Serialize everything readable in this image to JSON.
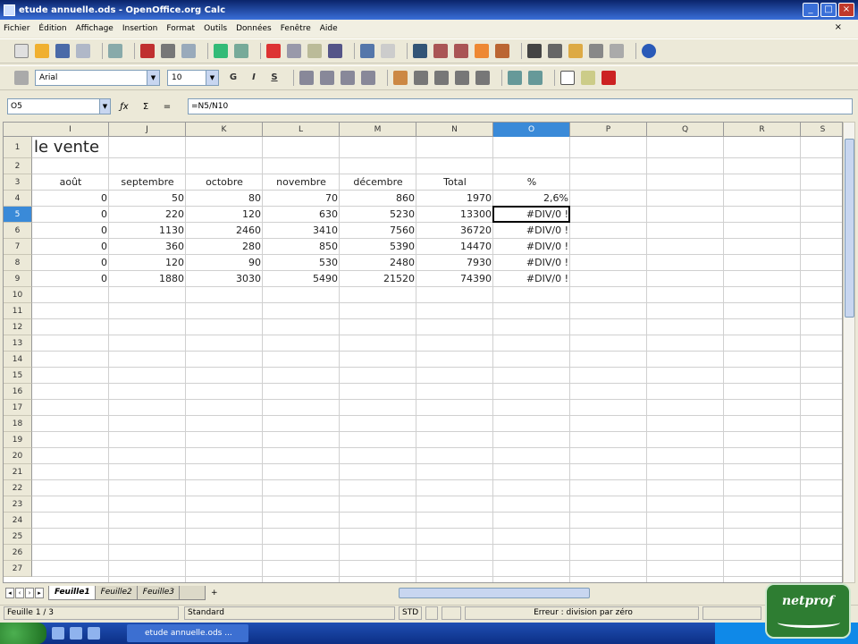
{
  "window": {
    "title": "etude annuelle.ods - OpenOffice.org Calc"
  },
  "menu": [
    "Fichier",
    "Édition",
    "Affichage",
    "Insertion",
    "Format",
    "Outils",
    "Données",
    "Fenêtre",
    "Aide"
  ],
  "toolbar_format": {
    "font_name": "Arial",
    "font_size": "10"
  },
  "formula_bar": {
    "cell_ref": "O5",
    "formula": "=N5/N10"
  },
  "columns": [
    "I",
    "J",
    "K",
    "L",
    "M",
    "N",
    "O",
    "P",
    "Q",
    "R",
    "S"
  ],
  "selected_column": "O",
  "selected_row": "5",
  "rows": [
    "1",
    "2",
    "3",
    "4",
    "5",
    "6",
    "7",
    "8",
    "9",
    "10",
    "11",
    "12",
    "13",
    "14",
    "15",
    "16",
    "17",
    "18",
    "19",
    "20",
    "21",
    "22",
    "23",
    "24",
    "25",
    "26",
    "27"
  ],
  "sheet": {
    "title_fragment": "le vente",
    "headers": [
      "août",
      "septembre",
      "octobre",
      "novembre",
      "décembre",
      "Total",
      "%"
    ],
    "data": [
      [
        "0",
        "50",
        "80",
        "70",
        "860",
        "1970",
        "2,6%"
      ],
      [
        "0",
        "220",
        "120",
        "630",
        "5230",
        "13300",
        "#DIV/0 !"
      ],
      [
        "0",
        "1130",
        "2460",
        "3410",
        "7560",
        "36720",
        "#DIV/0 !"
      ],
      [
        "0",
        "360",
        "280",
        "850",
        "5390",
        "14470",
        "#DIV/0 !"
      ],
      [
        "0",
        "120",
        "90",
        "530",
        "2480",
        "7930",
        "#DIV/0 !"
      ],
      [
        "0",
        "1880",
        "3030",
        "5490",
        "21520",
        "74390",
        "#DIV/0 !"
      ]
    ]
  },
  "tabs": [
    "Feuille1",
    "Feuille2",
    "Feuille3"
  ],
  "status": {
    "sheet": "Feuille 1 / 3",
    "style": "Standard",
    "mode": "STD",
    "message": "Erreur : division par zéro"
  },
  "taskbar": {
    "task": "etude annuelle.ods ..."
  },
  "logo": {
    "text": "netprof"
  },
  "colors": {
    "title_bar": "#0a246a",
    "selection": "#3a8ad8",
    "logo_bg": "#2e7d32"
  }
}
